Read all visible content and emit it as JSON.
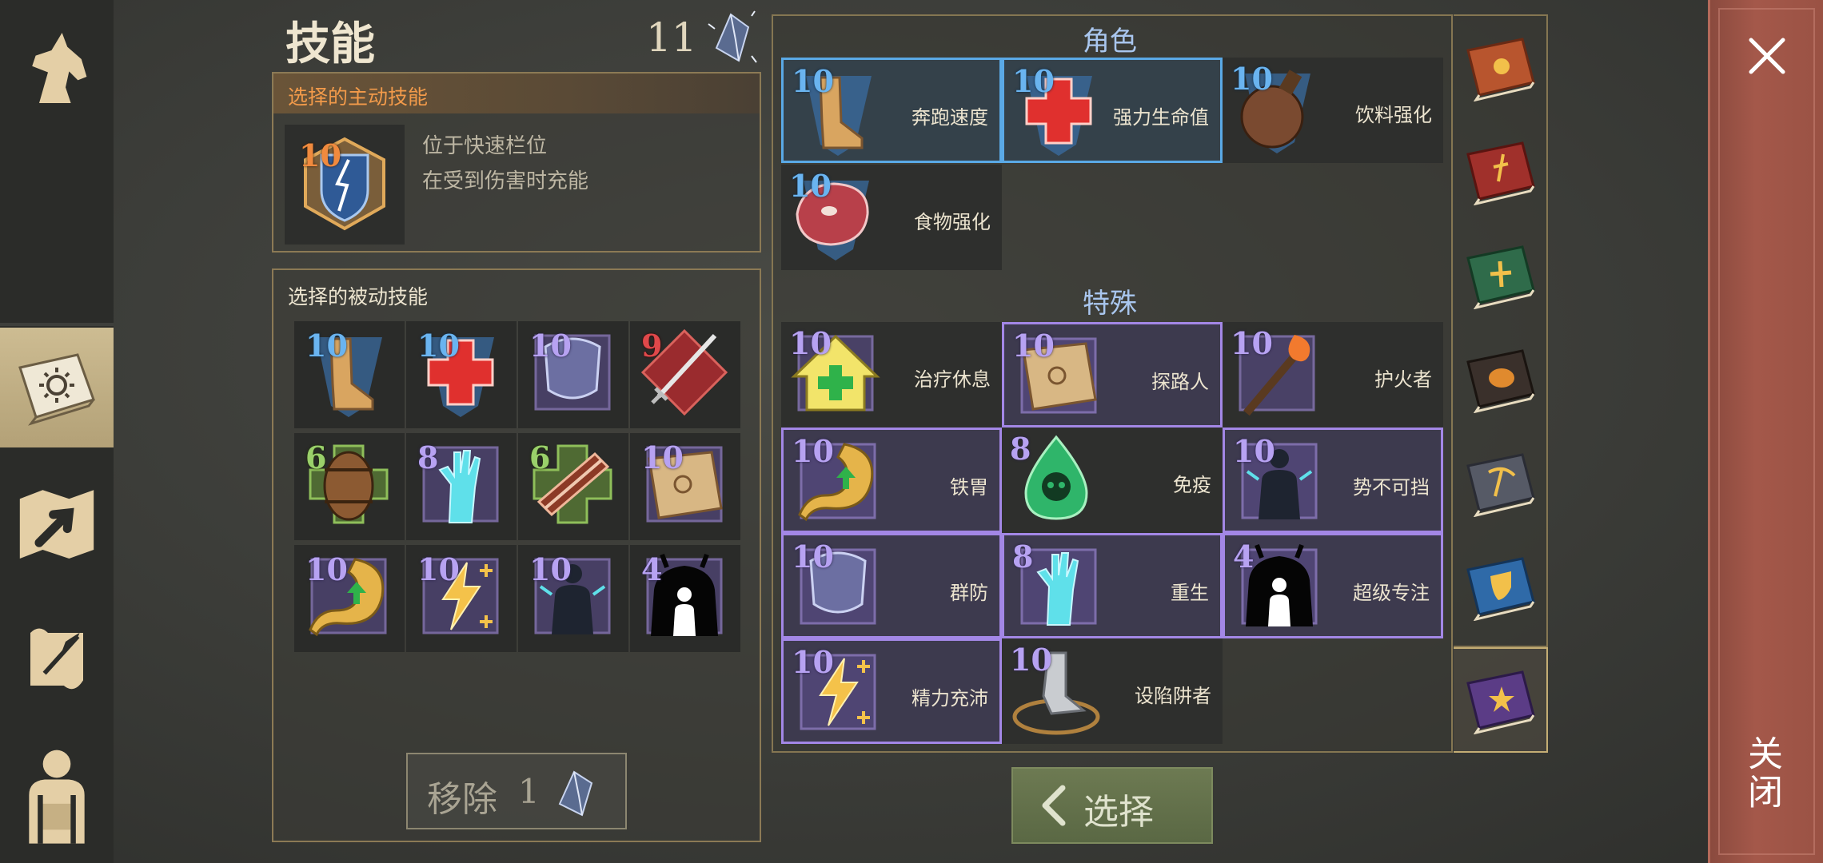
{
  "header": {
    "title": "技能",
    "crystal_count": "11"
  },
  "nav": {
    "items": [
      {
        "name": "horse-icon"
      },
      {
        "name": "skills-book-icon",
        "active": true
      },
      {
        "name": "map-arrow-icon"
      },
      {
        "name": "scroll-quill-icon"
      },
      {
        "name": "character-backpack-icon"
      }
    ]
  },
  "active_skill": {
    "title": "选择的主动技能",
    "level": "10",
    "icon": "shield-lightning-icon",
    "desc_line1": "位于快速栏位",
    "desc_line2": "在受到伤害时充能"
  },
  "passive_skills": {
    "title": "选择的被动技能",
    "slots": [
      {
        "level": "10",
        "icon": "boot-speed-icon",
        "color": "blue"
      },
      {
        "level": "10",
        "icon": "red-cross-icon",
        "color": "blue"
      },
      {
        "level": "10",
        "icon": "armor-shield-icon",
        "color": "purple"
      },
      {
        "level": "9",
        "icon": "sword-icon",
        "color": "red"
      },
      {
        "level": "6",
        "icon": "barrel-icon",
        "color": "green"
      },
      {
        "level": "8",
        "icon": "rising-hand-icon",
        "color": "purple"
      },
      {
        "level": "6",
        "icon": "bacon-icon",
        "color": "green"
      },
      {
        "level": "10",
        "icon": "treasure-map-icon",
        "color": "purple"
      },
      {
        "level": "10",
        "icon": "stomach-icon",
        "color": "purple"
      },
      {
        "level": "10",
        "icon": "energy-bolt-icon",
        "color": "purple"
      },
      {
        "level": "10",
        "icon": "unstoppable-figure-icon",
        "color": "purple"
      },
      {
        "level": "4",
        "icon": "demon-focus-icon",
        "color": "purple"
      }
    ],
    "remove_label": "移除",
    "remove_count": "1"
  },
  "character_section": {
    "title": "角色",
    "skills": [
      {
        "level": "10",
        "name": "奔跑速度",
        "icon": "boot-speed-icon",
        "state": "selected-blue"
      },
      {
        "level": "10",
        "name": "强力生命值",
        "icon": "red-cross-icon",
        "state": "selected-blue"
      },
      {
        "level": "10",
        "name": "饮料强化",
        "icon": "gourd-flask-icon",
        "state": "normal"
      },
      {
        "level": "10",
        "name": "食物强化",
        "icon": "raw-meat-icon",
        "state": "normal"
      }
    ]
  },
  "special_section": {
    "title": "特殊",
    "skills": [
      {
        "level": "10",
        "name": "治疗休息",
        "icon": "healing-house-icon",
        "state": "normal"
      },
      {
        "level": "10",
        "name": "探路人",
        "icon": "treasure-map-icon",
        "state": "selected-purple"
      },
      {
        "level": "10",
        "name": "护火者",
        "icon": "torch-icon",
        "state": "normal"
      },
      {
        "level": "10",
        "name": "铁胃",
        "icon": "stomach-icon",
        "state": "selected-purple"
      },
      {
        "level": "8",
        "name": "免疫",
        "icon": "poison-drop-icon",
        "state": "normal"
      },
      {
        "level": "10",
        "name": "势不可挡",
        "icon": "unstoppable-figure-icon",
        "state": "selected-purple"
      },
      {
        "level": "10",
        "name": "群防",
        "icon": "armor-shield-icon",
        "state": "selected-purple"
      },
      {
        "level": "8",
        "name": "重生",
        "icon": "rising-hand-icon",
        "state": "selected-purple"
      },
      {
        "level": "4",
        "name": "超级专注",
        "icon": "demon-focus-icon",
        "state": "selected-purple"
      },
      {
        "level": "10",
        "name": "精力充沛",
        "icon": "energy-bolt-icon",
        "state": "selected-purple"
      },
      {
        "level": "10",
        "name": "设陷阱者",
        "icon": "bear-trap-icon",
        "state": "normal"
      }
    ]
  },
  "book_tabs": [
    {
      "name": "sun-book-icon",
      "color": "#b8552e"
    },
    {
      "name": "dagger-book-icon",
      "color": "#a0302b"
    },
    {
      "name": "cross-book-icon",
      "color": "#2f6b4a"
    },
    {
      "name": "mask-book-icon",
      "color": "#3a302b"
    },
    {
      "name": "pickaxe-book-icon",
      "color": "#565a66"
    },
    {
      "name": "shield-book-icon",
      "color": "#2f6aa8"
    },
    {
      "name": "star-book-icon",
      "color": "#5b3c86",
      "active": true
    }
  ],
  "select_button": {
    "label": "选择"
  },
  "close": {
    "label": "关闭"
  }
}
